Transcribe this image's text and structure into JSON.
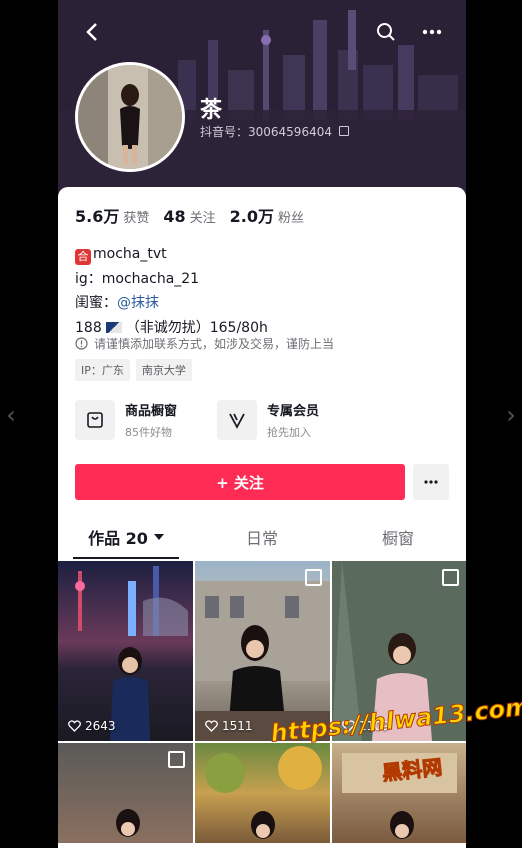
{
  "header": {
    "name": "茶",
    "uid": "抖音号：30064596404"
  },
  "stats": [
    {
      "num": "5.6万",
      "label": "获赞"
    },
    {
      "num": "48",
      "label": "关注"
    },
    {
      "num": "2.0万",
      "label": "粉丝"
    }
  ],
  "bio": {
    "line1_badge": "合",
    "line1": "mocha_tvt",
    "line2": "ig：mochacha_21",
    "line3_prefix": "闺蜜：",
    "line3_mention": "@抹抹",
    "line4_a": "188",
    "line4_b": "（非诚勿扰）165/80h"
  },
  "warning": "请谨慎添加联系方式，如涉及交易，谨防上当",
  "tags": [
    "IP：广东",
    "南京大学"
  ],
  "features": [
    {
      "title": "商品橱窗",
      "sub": "85件好物",
      "icon": "shop-bag-icon"
    },
    {
      "title": "专属会员",
      "sub": "抢先加入",
      "icon": "vip-v-icon"
    }
  ],
  "follow_label": "+ 关注",
  "tabs": [
    {
      "label": "作品 20"
    },
    {
      "label": "日常"
    },
    {
      "label": "橱窗"
    }
  ],
  "videos": [
    {
      "likes": "2643"
    },
    {
      "likes": "1511"
    },
    {
      "likes": "1109"
    }
  ],
  "watermark": "https://hlwa13.com",
  "watermark2": "黑料网",
  "colors": {
    "accent": "#fe2c55",
    "mention": "#2b5d9c"
  }
}
